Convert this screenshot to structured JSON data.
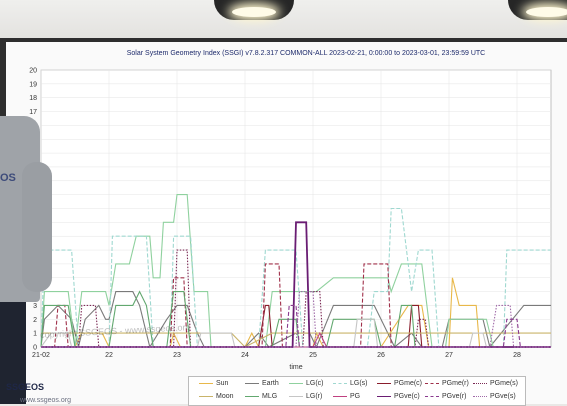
{
  "chart_data": {
    "type": "line",
    "title": "Solar System Geometry Index (SSGI) v7.8.2.317 COMMON-ALL 2023-02-21,  0:00:00 to 2023-03-01, 23:59:59 UTC",
    "xlabel": "time",
    "ylabel": "",
    "x_ticks": [
      "21-02",
      "22",
      "23",
      "24",
      "25",
      "26",
      "27",
      "28"
    ],
    "y_ticks": [
      "0",
      "1",
      "2",
      "3",
      "4",
      "5",
      "6",
      "7",
      "8",
      "9",
      "10",
      "11",
      "12",
      "13",
      "14",
      "15",
      "16",
      "17",
      "18",
      "19",
      "20"
    ],
    "xlim": [
      21,
      28.5
    ],
    "ylim": [
      0,
      20
    ],
    "grid": true,
    "legend_position": "bottom",
    "series": [
      {
        "name": "Sun",
        "color": "#e8b84a",
        "dash": "solid",
        "points": [
          [
            21,
            0
          ],
          [
            21.5,
            0
          ],
          [
            21.6,
            1
          ],
          [
            21.9,
            1
          ],
          [
            22,
            0
          ],
          [
            22.9,
            0
          ],
          [
            22.95,
            1
          ],
          [
            23.05,
            0
          ],
          [
            24,
            0
          ],
          [
            24.1,
            1
          ],
          [
            24.2,
            0
          ],
          [
            25,
            0
          ],
          [
            25.05,
            1
          ],
          [
            25.15,
            0
          ],
          [
            26,
            0
          ],
          [
            26.4,
            3
          ],
          [
            26.6,
            3
          ],
          [
            26.7,
            0
          ],
          [
            27,
            0
          ],
          [
            27.05,
            5
          ],
          [
            27.15,
            3
          ],
          [
            27.4,
            3
          ],
          [
            27.45,
            0
          ],
          [
            28.5,
            0
          ]
        ]
      },
      {
        "name": "Earth",
        "color": "#7a7a7a",
        "dash": "solid",
        "points": [
          [
            21,
            0
          ],
          [
            21.05,
            2
          ],
          [
            21.25,
            3
          ],
          [
            21.45,
            2
          ],
          [
            21.55,
            0
          ],
          [
            21.65,
            2
          ],
          [
            21.85,
            3
          ],
          [
            21.95,
            2
          ],
          [
            22,
            2
          ],
          [
            22.1,
            4
          ],
          [
            22.35,
            4
          ],
          [
            22.45,
            3
          ],
          [
            22.5,
            2
          ],
          [
            22.6,
            0
          ],
          [
            22.85,
            2
          ],
          [
            23,
            3
          ],
          [
            23.15,
            3
          ],
          [
            23.3,
            1
          ],
          [
            23.4,
            0
          ],
          [
            24,
            0
          ],
          [
            24.2,
            1
          ],
          [
            24.35,
            0
          ],
          [
            24.75,
            1
          ],
          [
            24.95,
            1
          ],
          [
            25.05,
            0
          ],
          [
            25.3,
            3
          ],
          [
            25.9,
            3
          ],
          [
            26,
            2
          ],
          [
            26.2,
            0
          ],
          [
            26.45,
            1
          ],
          [
            26.6,
            0
          ],
          [
            26.9,
            0
          ],
          [
            27,
            2
          ],
          [
            27.5,
            2
          ],
          [
            27.6,
            0
          ],
          [
            28.1,
            3
          ],
          [
            28.5,
            3
          ]
        ]
      },
      {
        "name": "LG(c)",
        "color": "#8fd19e",
        "dash": "solid",
        "points": [
          [
            21,
            0
          ],
          [
            21.05,
            4
          ],
          [
            21.4,
            4
          ],
          [
            21.5,
            0
          ],
          [
            21.6,
            4
          ],
          [
            21.95,
            4
          ],
          [
            22,
            3
          ],
          [
            22.1,
            6
          ],
          [
            22.3,
            6
          ],
          [
            22.4,
            8
          ],
          [
            22.6,
            8
          ],
          [
            22.65,
            5
          ],
          [
            22.75,
            5
          ],
          [
            22.8,
            9
          ],
          [
            22.95,
            9
          ],
          [
            23,
            11
          ],
          [
            23.15,
            11
          ],
          [
            23.25,
            4
          ],
          [
            23.45,
            4
          ],
          [
            23.5,
            0
          ],
          [
            24.3,
            0
          ],
          [
            24.4,
            4
          ],
          [
            25.05,
            4
          ],
          [
            25.3,
            5
          ],
          [
            26.1,
            5
          ],
          [
            26.15,
            4
          ],
          [
            26.3,
            6
          ],
          [
            26.6,
            6
          ],
          [
            26.75,
            0
          ],
          [
            26.95,
            0
          ],
          [
            27,
            2
          ],
          [
            27.55,
            2
          ],
          [
            27.65,
            0
          ],
          [
            28.5,
            0
          ]
        ]
      },
      {
        "name": "LG(s)",
        "color": "#9fd8d0",
        "dash": "dashed",
        "points": [
          [
            21,
            0
          ],
          [
            21.05,
            7
          ],
          [
            21.45,
            7
          ],
          [
            21.55,
            0
          ],
          [
            22,
            0
          ],
          [
            22.05,
            8
          ],
          [
            22.55,
            8
          ],
          [
            22.65,
            0
          ],
          [
            22.9,
            0
          ],
          [
            22.95,
            8
          ],
          [
            23.2,
            8
          ],
          [
            23.3,
            0
          ],
          [
            24.2,
            0
          ],
          [
            24.3,
            7
          ],
          [
            24.75,
            7
          ],
          [
            24.85,
            0
          ],
          [
            25.8,
            0
          ],
          [
            25.9,
            4
          ],
          [
            26.1,
            4
          ],
          [
            26.15,
            10
          ],
          [
            26.3,
            10
          ],
          [
            26.45,
            4
          ],
          [
            26.55,
            7
          ],
          [
            26.75,
            7
          ],
          [
            26.85,
            0
          ],
          [
            27.8,
            0
          ],
          [
            27.85,
            7
          ],
          [
            28.5,
            7
          ]
        ]
      },
      {
        "name": "PGme(c)",
        "color": "#8a1d2c",
        "dash": "solid",
        "points": [
          [
            21,
            0
          ],
          [
            21.6,
            0
          ],
          [
            21.7,
            0
          ],
          [
            22,
            0
          ],
          [
            24.2,
            0
          ],
          [
            24.3,
            3
          ],
          [
            24.35,
            3
          ],
          [
            24.4,
            0
          ],
          [
            26.4,
            0
          ],
          [
            26.45,
            3
          ],
          [
            26.55,
            3
          ],
          [
            26.6,
            0
          ],
          [
            28.5,
            0
          ]
        ]
      },
      {
        "name": "PGme(r)",
        "color": "#a0304a",
        "dash": "dashed",
        "points": [
          [
            21,
            0
          ],
          [
            21.2,
            0
          ],
          [
            21.25,
            3
          ],
          [
            21.35,
            3
          ],
          [
            21.4,
            0
          ],
          [
            22.9,
            0
          ],
          [
            22.95,
            5
          ],
          [
            23.1,
            5
          ],
          [
            23.15,
            0
          ],
          [
            24.25,
            0
          ],
          [
            24.3,
            6
          ],
          [
            24.5,
            6
          ],
          [
            24.55,
            0
          ],
          [
            25.7,
            0
          ],
          [
            25.75,
            6
          ],
          [
            26.1,
            6
          ],
          [
            26.15,
            0
          ],
          [
            28.5,
            0
          ]
        ]
      },
      {
        "name": "PGme(s)",
        "color": "#7b2a55",
        "dash": "dotted",
        "points": [
          [
            21,
            0
          ],
          [
            21.55,
            0
          ],
          [
            21.6,
            3
          ],
          [
            21.8,
            3
          ],
          [
            21.85,
            0
          ],
          [
            22.95,
            0
          ],
          [
            23,
            7
          ],
          [
            23.15,
            7
          ],
          [
            23.2,
            0
          ],
          [
            24.85,
            0
          ],
          [
            24.9,
            4
          ],
          [
            25.1,
            4
          ],
          [
            25.15,
            0
          ],
          [
            26.5,
            0
          ],
          [
            26.55,
            2
          ],
          [
            26.65,
            2
          ],
          [
            26.7,
            0
          ],
          [
            28.5,
            0
          ]
        ]
      },
      {
        "name": "Moon",
        "color": "#c9b46a",
        "dash": "solid",
        "points": [
          [
            21,
            1
          ],
          [
            22,
            1
          ],
          [
            23,
            1
          ],
          [
            23.3,
            1
          ],
          [
            23.8,
            1
          ],
          [
            24,
            0
          ],
          [
            24.4,
            1
          ],
          [
            25,
            1
          ],
          [
            26,
            1
          ],
          [
            26.5,
            1
          ],
          [
            27,
            1
          ],
          [
            28,
            1
          ],
          [
            28.5,
            1
          ]
        ]
      },
      {
        "name": "MLG",
        "color": "#62a86f",
        "dash": "solid",
        "points": [
          [
            21,
            0
          ],
          [
            21.05,
            3
          ],
          [
            21.4,
            3
          ],
          [
            21.5,
            0
          ],
          [
            22,
            0
          ],
          [
            22.1,
            3
          ],
          [
            22.35,
            3
          ],
          [
            22.45,
            4
          ],
          [
            22.55,
            3
          ],
          [
            22.65,
            0
          ],
          [
            22.85,
            0
          ],
          [
            22.95,
            4
          ],
          [
            23.1,
            4
          ],
          [
            23.2,
            0
          ],
          [
            24.4,
            0
          ],
          [
            24.5,
            2
          ],
          [
            24.75,
            2
          ],
          [
            24.8,
            0
          ],
          [
            25.2,
            0
          ],
          [
            25.3,
            2
          ],
          [
            25.9,
            2
          ],
          [
            26,
            0
          ],
          [
            26.2,
            0
          ],
          [
            26.3,
            3
          ],
          [
            26.45,
            3
          ],
          [
            26.5,
            0
          ],
          [
            28.5,
            0
          ]
        ]
      },
      {
        "name": "LG(r)",
        "color": "#c6c6c6",
        "dash": "solid",
        "points": [
          [
            21,
            0
          ],
          [
            21.15,
            1
          ],
          [
            21.4,
            1
          ],
          [
            21.45,
            0
          ],
          [
            22,
            0
          ],
          [
            23.3,
            0
          ],
          [
            23.35,
            1
          ],
          [
            23.8,
            1
          ],
          [
            23.85,
            0
          ],
          [
            25.6,
            0
          ],
          [
            25.65,
            2
          ],
          [
            25.9,
            2
          ],
          [
            25.95,
            0
          ],
          [
            27.3,
            0
          ],
          [
            27.35,
            1
          ],
          [
            27.5,
            1
          ],
          [
            27.55,
            0
          ],
          [
            28.5,
            0
          ]
        ]
      },
      {
        "name": "PG",
        "color": "#c04080",
        "dash": "solid",
        "points": [
          [
            21,
            0
          ],
          [
            24,
            0
          ],
          [
            25,
            0
          ],
          [
            25.1,
            1
          ],
          [
            25.2,
            0
          ],
          [
            28.5,
            0
          ]
        ]
      },
      {
        "name": "PGve(c)",
        "color": "#6a1d73",
        "dash": "solid",
        "points": [
          [
            21,
            0
          ],
          [
            24.7,
            0
          ],
          [
            24.75,
            9
          ],
          [
            24.9,
            9
          ],
          [
            24.95,
            0
          ],
          [
            28.5,
            0
          ]
        ]
      },
      {
        "name": "PGve(r)",
        "color": "#8a3a8f",
        "dash": "dashed",
        "points": [
          [
            21,
            0
          ],
          [
            24.6,
            0
          ],
          [
            24.65,
            3
          ],
          [
            24.75,
            3
          ],
          [
            24.8,
            0
          ],
          [
            27.8,
            0
          ],
          [
            27.85,
            2
          ],
          [
            28.0,
            2
          ],
          [
            28.05,
            0
          ],
          [
            28.5,
            0
          ]
        ]
      },
      {
        "name": "PGve(s)",
        "color": "#a06aa8",
        "dash": "dotted",
        "points": [
          [
            21,
            0
          ],
          [
            24.75,
            0
          ],
          [
            24.8,
            4
          ],
          [
            25,
            4
          ],
          [
            25.05,
            0
          ],
          [
            27.6,
            0
          ],
          [
            27.7,
            3
          ],
          [
            27.9,
            3
          ],
          [
            27.95,
            0
          ],
          [
            28.5,
            0
          ]
        ]
      }
    ]
  },
  "presenter": {
    "shirt_text": "OS"
  },
  "overlay": {
    "watermark": "copyright SSGEOS - www.ssgeos.org"
  },
  "footer": {
    "brand": "SSGEOS",
    "brand_sub": "www.ssgeos.org"
  }
}
